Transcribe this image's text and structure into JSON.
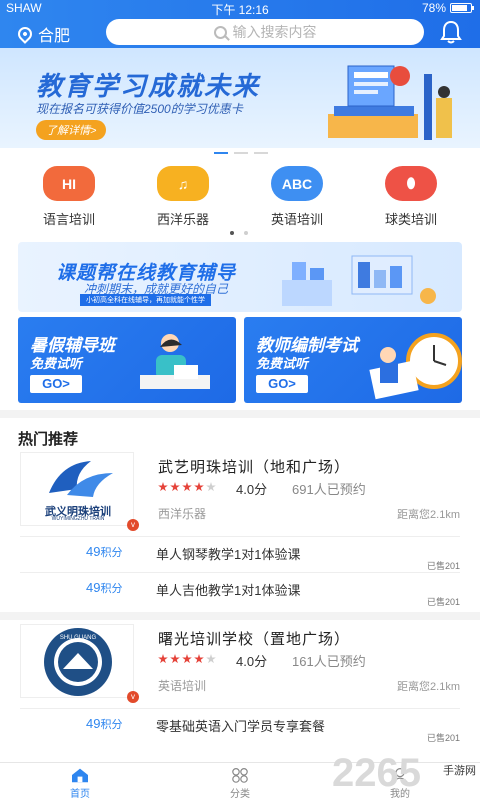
{
  "status": {
    "carrier": "SHAW",
    "time": "下午 12:16",
    "battery": "78%"
  },
  "header": {
    "city": "合肥",
    "search_placeholder": "输入搜索内容"
  },
  "banner": {
    "title": "教育学习成就未来",
    "subtitle": "现在报名可获得价值2500的学习优惠卡",
    "button": "了解详情>"
  },
  "categories": [
    {
      "label": "语言培训",
      "icon_text": "HI",
      "color": "#f26a3c"
    },
    {
      "label": "西洋乐器",
      "icon_text": "♫",
      "color": "#f7b121"
    },
    {
      "label": "英语培训",
      "icon_text": "ABC",
      "color": "#3e8ff2"
    },
    {
      "label": "球类培训",
      "icon_text": "⬮",
      "color": "#ee5246"
    }
  ],
  "promo": {
    "title": "课题帮在线教育辅导",
    "subtitle": "冲刺期末，成就更好的自己",
    "tag": "小初高全科在线辅导，再加就能个性学"
  },
  "cards": [
    {
      "title": "暑假辅导班",
      "sub": "免费试听",
      "go": "GO>"
    },
    {
      "title": "教师编制考试",
      "sub": "免费试听",
      "go": "GO>"
    }
  ],
  "section_title": "热门推荐",
  "schools": [
    {
      "name": "武艺明珠培训（地和广场）",
      "rating_value": 4,
      "score": "4.0分",
      "booked": "691人已预约",
      "category": "西洋乐器",
      "distance": "距离您2.1km",
      "logo_text": "武义明珠培训",
      "logo_sub": "WUYIMINGZHU TRAIN",
      "courses": [
        {
          "points": "49",
          "unit": "积分",
          "name": "单人钢琴教学1对1体验课",
          "sold": "已售201"
        },
        {
          "points": "49",
          "unit": "积分",
          "name": "单人吉他教学1对1体验课",
          "sold": "已售201"
        }
      ]
    },
    {
      "name": "曙光培训学校（置地广场）",
      "rating_value": 4,
      "score": "4.0分",
      "booked": "161人已预约",
      "category": "英语培训",
      "distance": "距离您2.1km",
      "logo_text": "SHU GUANG",
      "courses": [
        {
          "points": "49",
          "unit": "积分",
          "name": "零基础英语入门学员专享套餐",
          "sold": "已售201"
        }
      ]
    }
  ],
  "tabs": [
    {
      "label": "首页",
      "icon": "home-icon",
      "active": true
    },
    {
      "label": "分类",
      "icon": "grid-icon",
      "active": false
    },
    {
      "label": "我的",
      "icon": "user-icon",
      "active": false
    }
  ],
  "watermark": {
    "brand": "2265",
    "text": "手游网"
  },
  "colors": {
    "primary": "#2f86ef",
    "star": "#e5433a"
  }
}
